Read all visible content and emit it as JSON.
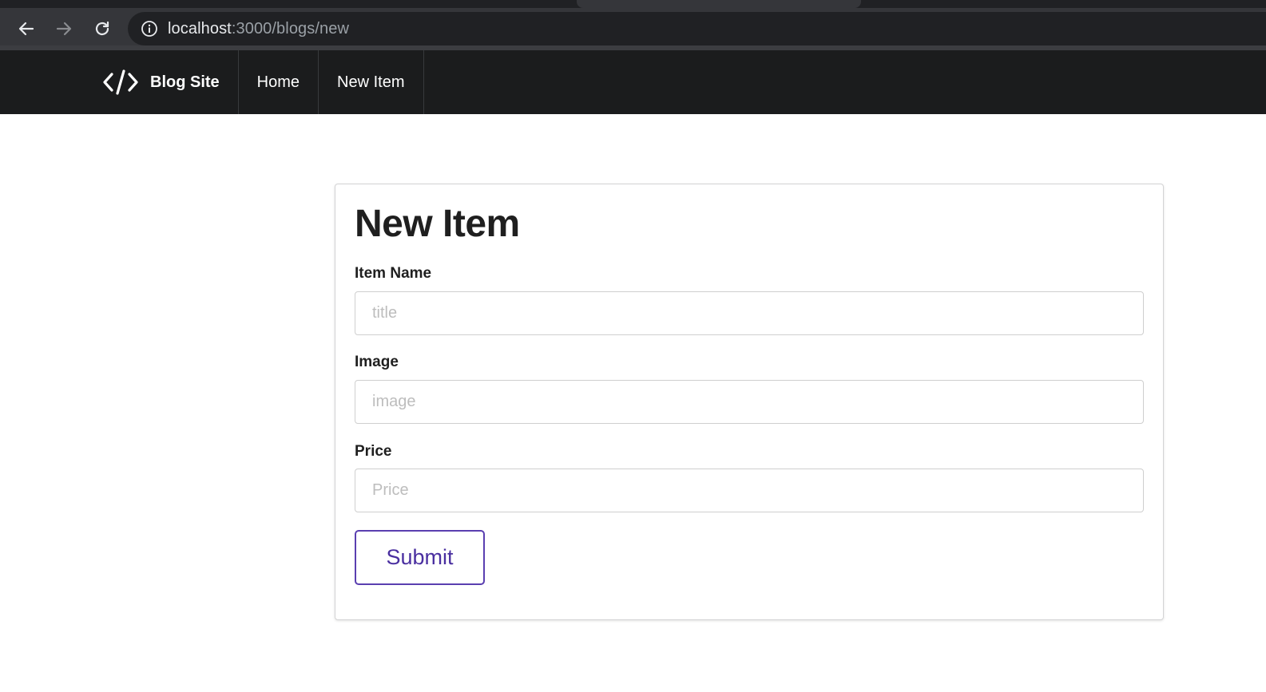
{
  "browser": {
    "url_host": "localhost",
    "url_path": ":3000/blogs/new"
  },
  "navbar": {
    "brand_icon": "code-icon",
    "brand_label": "Blog Site",
    "items": [
      {
        "label": "Home"
      },
      {
        "label": "New Item"
      }
    ]
  },
  "form": {
    "title": "New Item",
    "fields": [
      {
        "label": "Item Name",
        "placeholder": "title",
        "value": ""
      },
      {
        "label": "Image",
        "placeholder": "image",
        "value": ""
      },
      {
        "label": "Price",
        "placeholder": "Price",
        "value": ""
      }
    ],
    "submit_label": "Submit"
  },
  "colors": {
    "chrome_bg": "#35363a",
    "navbar_bg": "#1b1c1d",
    "submit_accent": "#5a3fb0"
  }
}
